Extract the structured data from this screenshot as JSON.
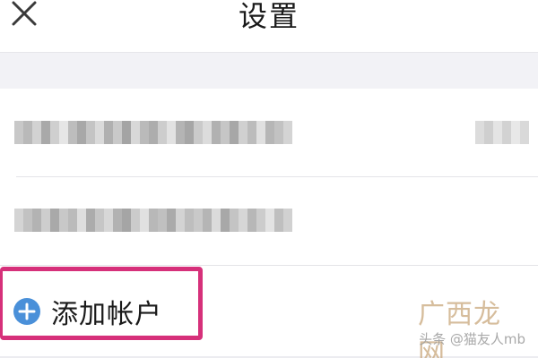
{
  "nav": {
    "title": "设置",
    "close_icon": "close-icon"
  },
  "accounts": [
    {
      "email": "",
      "display": "blurred-email"
    },
    {
      "email": "",
      "display": "blurred-email"
    }
  ],
  "add_account": {
    "label": "添加帐户",
    "icon": "plus-circle-icon",
    "icon_color": "#4a90d9"
  },
  "highlight": {
    "color": "#d6307a"
  },
  "watermark": {
    "text": "广西龙网",
    "sub": "头条 @猫友人mb"
  }
}
